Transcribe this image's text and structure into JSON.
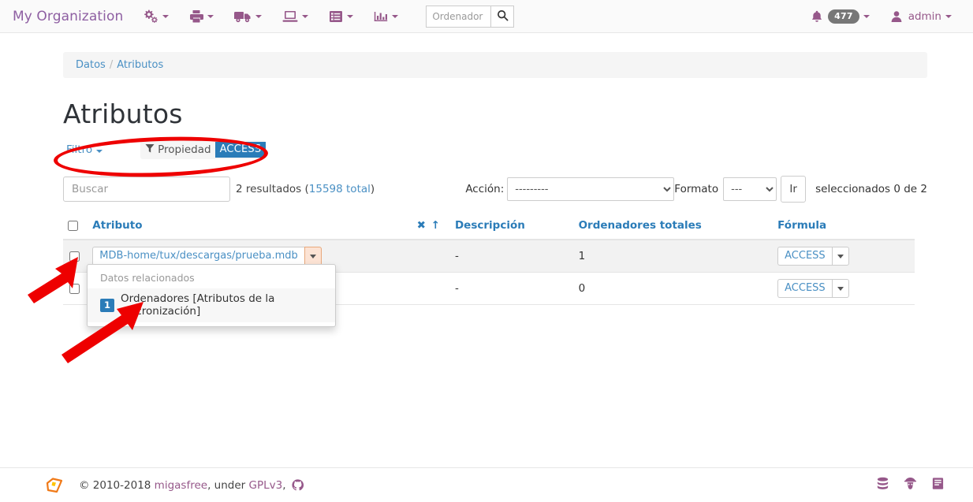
{
  "navbar": {
    "brand": "My Organization",
    "menus": [
      {
        "icon": "cogs-icon",
        "name": "configuration-menu"
      },
      {
        "icon": "print-icon",
        "name": "deployments-menu"
      },
      {
        "icon": "truck-icon",
        "name": "release-menu"
      },
      {
        "icon": "desktop-icon",
        "name": "computers-menu"
      },
      {
        "icon": "list-alt-icon",
        "name": "data-menu"
      },
      {
        "icon": "bar-chart-icon",
        "name": "stats-menu"
      }
    ],
    "search": {
      "placeholder": "Ordenador",
      "value": "",
      "icon": "search-icon"
    },
    "notifications": {
      "icon": "bell-icon",
      "count": "477"
    },
    "user": {
      "icon": "user-icon",
      "name": "admin"
    }
  },
  "breadcrumb": {
    "root": "Datos",
    "separator": "/",
    "current": "Atributos"
  },
  "page": {
    "title": "Atributos"
  },
  "filter": {
    "toggle_label": "Filtro",
    "chip": {
      "icon": "filter-icon",
      "label": "Propiedad",
      "value": "ACCESS"
    }
  },
  "toolbar": {
    "search_placeholder": "Buscar",
    "search_value": "",
    "results_text": "2 resultados (",
    "results_total": "15598 total",
    "results_suffix": ")",
    "action_label": "Acción:",
    "action_value": "---------",
    "format_label": "Formato",
    "format_value": "---",
    "go_label": "Ir",
    "selected_text": "seleccionados 0 de 2"
  },
  "table": {
    "headers": {
      "attribute": "Atributo",
      "description": "Descripción",
      "total_computers": "Ordenadores totales",
      "formula": "Fórmula"
    },
    "sort_icons": {
      "clear": "✖",
      "asc": "↑"
    },
    "rows": [
      {
        "attribute": "MDB-home/tux/descargas/prueba.mdb",
        "description": "-",
        "total_computers": "1",
        "formula": "ACCESS",
        "checked": false,
        "highlighted": true
      },
      {
        "attribute": "",
        "description": "-",
        "total_computers": "0",
        "formula": "ACCESS",
        "checked": false,
        "highlighted": false
      }
    ]
  },
  "dropdown": {
    "header": "Datos relacionados",
    "items": [
      {
        "badge": "1",
        "label": "Ordenadores [Atributos de la sincronización]"
      }
    ]
  },
  "footer": {
    "logo_icon": "migasfree-logo-icon",
    "copyright": "© 2010-2018 ",
    "project": "migasfree",
    "license_prefix": ", under ",
    "license": "GPLv3",
    "license_suffix": ",",
    "github_icon": "github-icon",
    "right_icons": [
      {
        "icon": "database-icon",
        "name": "database-link"
      },
      {
        "icon": "detective-icon",
        "name": "detective-link"
      },
      {
        "icon": "book-icon",
        "name": "documentation-link"
      }
    ]
  },
  "colors": {
    "brand_purple": "#96588a",
    "link_blue": "#4a90c4",
    "header_blue": "#2b7cb8",
    "badge_blue": "#2b7cb8",
    "annotation_red": "#ee0000",
    "highlight_peach": "#fce3d4"
  }
}
